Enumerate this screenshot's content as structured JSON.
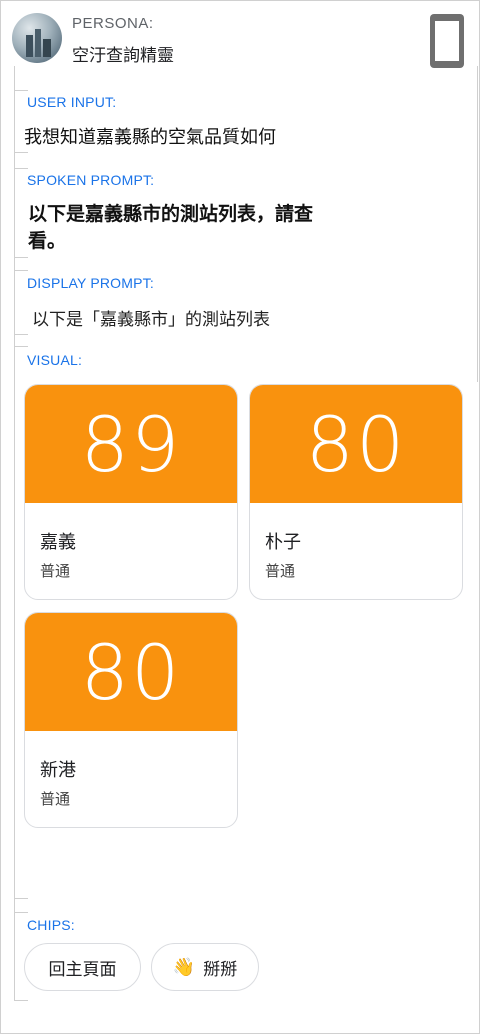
{
  "persona": {
    "label": "PERSONA:",
    "name": "空汙查詢精靈"
  },
  "sections": {
    "user_input_label": "USER INPUT:",
    "spoken_label": "SPOKEN PROMPT:",
    "display_label": "DISPLAY PROMPT:",
    "visual_label": "VISUAL:",
    "chips_label": "CHIPS:"
  },
  "user_input": "我想知道嘉義縣的空氣品質如何",
  "spoken_prompt": "以下是嘉義縣市的測站列表，請查看。",
  "display_prompt": "以下是「嘉義縣市」的測站列表",
  "cards": [
    {
      "value": "89",
      "title": "嘉義",
      "status": "普通"
    },
    {
      "value": "80",
      "title": "朴子",
      "status": "普通"
    },
    {
      "value": "80",
      "title": "新港",
      "status": "普通"
    }
  ],
  "chips": [
    {
      "label": "回主頁面"
    },
    {
      "icon": "waving-hand-icon",
      "glyph": "👋",
      "label": "掰掰"
    }
  ],
  "colors": {
    "accent": "#1a73e8",
    "card_top": "#f9920e"
  }
}
